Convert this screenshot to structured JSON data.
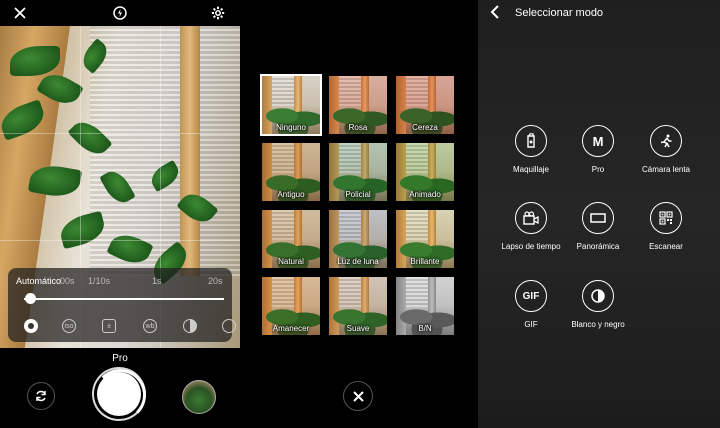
{
  "camera": {
    "top_icons": [
      "close-icon",
      "flash-auto-icon",
      "settings-gear-icon"
    ],
    "pro_controls": {
      "auto_label": "Automático",
      "shutter_ticks": [
        "00s",
        "1/10s",
        "1s",
        "20s"
      ],
      "slider_fraction": 0.03,
      "manual_icons": [
        "aperture-icon",
        "iso-icon",
        "exposure-icon",
        "white-balance-icon",
        "contrast-icon",
        "more-icon"
      ]
    },
    "mode_label": "Pro",
    "buttons": {
      "switch_camera": "camera-switch-icon",
      "shutter": "shutter-button",
      "gallery": "gallery-thumbnail"
    }
  },
  "filters": {
    "tiles": [
      {
        "name": "Ninguno",
        "selected": true,
        "tint": "none"
      },
      {
        "name": "Rosa",
        "selected": false,
        "tint": "#ffb0a0"
      },
      {
        "name": "Cereza",
        "selected": false,
        "tint": "#ff9a8a"
      },
      {
        "name": "Antiguo",
        "selected": false,
        "tint": "#e8c088"
      },
      {
        "name": "Policial",
        "selected": false,
        "tint": "#b0e0d0"
      },
      {
        "name": "Animado",
        "selected": false,
        "tint": "#c0f0a0"
      },
      {
        "name": "Natural",
        "selected": false,
        "tint": "#f0d0a0"
      },
      {
        "name": "Luz de luna",
        "selected": false,
        "tint": "#c8d8f8"
      },
      {
        "name": "Brillante",
        "selected": false,
        "tint": "#ffffd0"
      },
      {
        "name": "Amanecer",
        "selected": false,
        "tint": "#ffc890"
      },
      {
        "name": "Suave",
        "selected": false,
        "tint": "#f0e0d8"
      },
      {
        "name": "B/N",
        "selected": false,
        "tint": "grayscale"
      }
    ],
    "close_icon": "close-icon"
  },
  "modes": {
    "title": "Seleccionar modo",
    "back_icon": "back-arrow-icon",
    "items": [
      {
        "label": "Maquillaje",
        "icon": "makeup-icon"
      },
      {
        "label": "Pro",
        "icon": "pro-m-icon"
      },
      {
        "label": "Cámara lenta",
        "icon": "slow-motion-icon"
      },
      {
        "label": "Lapso de tiempo",
        "icon": "timelapse-icon"
      },
      {
        "label": "Panorámica",
        "icon": "panorama-icon"
      },
      {
        "label": "Escanear",
        "icon": "qr-scan-icon"
      },
      {
        "label": "GIF",
        "icon": "gif-icon"
      },
      {
        "label": "Blanco y negro",
        "icon": "black-white-icon"
      }
    ]
  }
}
